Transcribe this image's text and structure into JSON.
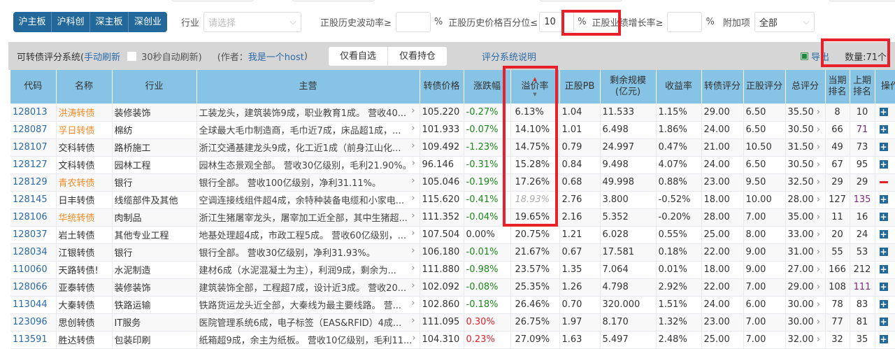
{
  "filters": {
    "markets": [
      "沪主板",
      "沪科创",
      "深主板",
      "深创业"
    ],
    "industry_label": "行业",
    "industry_placeholder": "请选择",
    "volatility_label": "正股历史波动率≥",
    "volatility_value": "",
    "pct": "%",
    "price_pct_label": "正股历史价格百分位≤",
    "price_pct_value": "10",
    "growth_label": "正股业绩增长率≥",
    "growth_value": "",
    "extra_label": "附加项",
    "extra_value": "全部"
  },
  "toolbar": {
    "title": "可转债评分系统(",
    "manual_refresh": "手动刷新",
    "auto_refresh": "30秒自动刷新)",
    "author_prefix": "(作者：",
    "author": "我是一个host",
    ")": ")",
    "only_watch": "仅看自选",
    "only_holding": "仅看持仓",
    "score_doc": "评分系统说明",
    "export": "导出",
    "count": "数量:71个"
  },
  "columns": [
    "代码",
    "名称",
    "行业",
    "主营",
    "转债价格",
    "涨跌幅",
    "溢价率",
    "正股PB",
    "剩余规模\n(亿元)",
    "收益率",
    "转债评分",
    "正股评分",
    "总评分",
    "当期\n排名",
    "上期\n排名",
    "操作"
  ],
  "sort_column": "溢价率",
  "rows": [
    [
      "128013",
      "洪涛转债",
      "装修装饰",
      "工装龙头，建筑装饰9成，职业教育1成。 营收40...",
      "105.220",
      "-0.27%",
      "6.13%",
      "1.04",
      "11.533",
      "1.15%",
      "29.00",
      "6.50",
      "35.50",
      "8",
      "10",
      "add"
    ],
    [
      "128087",
      "孚日转债",
      "棉纺",
      "全球最大毛巾制造商，毛巾近7成，床品超1成，...",
      "101.933",
      "-0.07%",
      "14.10%",
      "1.01",
      "6.498",
      "1.86%",
      "24.00",
      "6.50",
      "30.50",
      "66",
      "71",
      "add"
    ],
    [
      "128107",
      "交科转债",
      "路桥施工",
      "浙江交通基建龙头9成，化工近1成（前身江山化...",
      "109.492",
      "-1.23%",
      "14.75%",
      "0.79",
      "24.997",
      "0.47%",
      "21.00",
      "10.50",
      "31.50",
      "49",
      "73",
      "add"
    ],
    [
      "128127",
      "文科转债",
      "园林工程",
      "园林生态景观全部。 营收30亿级别，毛利21.90%。",
      "96.146",
      "-0.31%",
      "15.28%",
      "0.84",
      "9.498",
      "4.07%",
      "24.00",
      "6.50",
      "30.50",
      "67",
      "95",
      "add"
    ],
    [
      "128129",
      "青农转债",
      "银行",
      "银行全部。 营收100亿级别，净利31.11%。",
      "105.046",
      "-0.19%",
      "17.26%",
      "0.68",
      "49.998",
      "0.88%",
      "23.00",
      "9.50",
      "32.50",
      "29",
      "29",
      "remove"
    ],
    [
      "128145",
      "日丰转债",
      "线缆部件及其他",
      "空调连接线组件超4成，余特种装备电缆和小家电...",
      "115.620",
      "-0.41%",
      "18.93%",
      "2.76",
      "3.800",
      "-0.52%",
      "18.00",
      "10.00",
      "28.00",
      "127",
      "135",
      "add"
    ],
    [
      "128106",
      "华统转债",
      "肉制品",
      "浙江生猪屠宰龙头，屠宰加工近全部，其中生猪超...",
      "111.352",
      "-0.04%",
      "19.65%",
      "2.16",
      "5.352",
      "-0.20%",
      "28.00",
      "7.00",
      "35.00",
      "11",
      "16",
      "add"
    ],
    [
      "128037",
      "岩土转债",
      "其他专业工程",
      "地基处理超4成，市政工程5成。 营收60亿级别，...",
      "107.504",
      "0.00%",
      "20.75%",
      "1.21",
      "6.028",
      "0.55%",
      "25.00",
      "8.00",
      "33.00",
      "20",
      "24",
      "add"
    ],
    [
      "128034",
      "江银转债",
      "银行",
      "银行全部。 营收30亿级别，净利31.93%。",
      "106.180",
      "-0.01%",
      "21.67%",
      "0.67",
      "17.581",
      "0.18%",
      "22.00",
      "9.00",
      "31.00",
      "55",
      "53",
      "add"
    ],
    [
      "110060",
      "天路转债!",
      "水泥制造",
      "建材6成（水泥混凝土为主），利润9成，剩余为...",
      "111.880",
      "-0.98%",
      "23.57%",
      "1.35",
      "7.064",
      "0.01%",
      "18.00",
      "9.00",
      "27.00",
      "166",
      "212",
      "add"
    ],
    [
      "128066",
      "亚泰转债",
      "装修装饰",
      "建筑装饰全部，工程超7成，设计近3成。 营收20...",
      "102.092",
      "-0.08%",
      "25.35%",
      "1.26",
      "4.798",
      "2.92%",
      "22.00",
      "7.00",
      "29.00",
      "108",
      "111",
      "add"
    ],
    [
      "113044",
      "大秦转债",
      "铁路运输",
      "铁路货运龙头近全部，大秦线为最主要线路。 营...",
      "102.860",
      "-0.18%",
      "26.46%",
      "0.70",
      "320.000",
      "1.51%",
      "24.00",
      "6.00",
      "30.00",
      "78",
      "83",
      "add"
    ],
    [
      "123096",
      "思创转债",
      "IT服务",
      "医院管理系统6成，电子标签（EAS&RFID）4成...",
      "111.095",
      "0.30%",
      "26.75%",
      "1.97",
      "8.170",
      "1.32%",
      "23.00",
      "7.00",
      "30.00",
      "77",
      "81",
      "add"
    ],
    [
      "113591",
      "胜达转债",
      "包装印刷",
      "纸箱超9成，余主为纸板。 营收10亿级别，毛利11...",
      "104.310",
      "0.23%",
      "27.09%",
      "1.63",
      "5.497",
      "2.48%",
      "25.00",
      "7.00",
      "32.00",
      "32",
      "35",
      "add"
    ]
  ],
  "highlighted_names": [
    "洪涛转债",
    "孚日转债",
    "青农转债",
    "华统转债"
  ],
  "colors": {
    "accent": "#23689b",
    "header_bg": "#86c3e4",
    "up": "#e0202a",
    "down": "#1a8a1a",
    "highlight_name": "#f08a24",
    "annotation": "#e8202a"
  }
}
